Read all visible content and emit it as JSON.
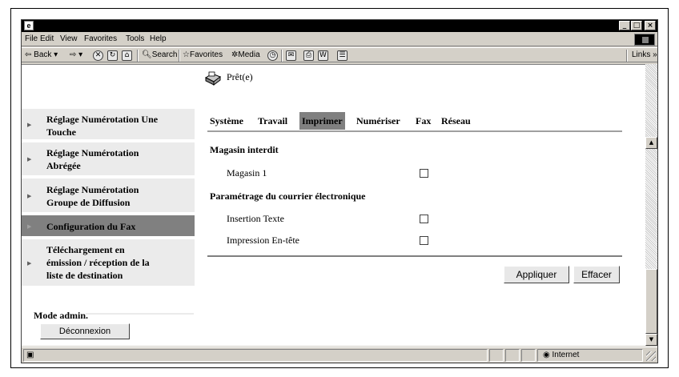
{
  "window": {
    "title_icon": "ie-page-icon",
    "controls": {
      "minimize": "_",
      "maximize": "□",
      "close": "×"
    }
  },
  "menu": {
    "items": [
      "File",
      "Edit",
      "View",
      "Favorites",
      "Tools",
      "Help"
    ]
  },
  "toolbar": {
    "back": "Back",
    "search": "Search",
    "favorites": "Favorites",
    "media": "Media",
    "links": "Links »"
  },
  "status": {
    "text": "Prêt(e)"
  },
  "sidebar": {
    "items": [
      {
        "label_lines": [
          "Réglage Numérotation Une",
          "Touche"
        ],
        "active": false
      },
      {
        "label_lines": [
          "Réglage Numérotation",
          "Abrégée"
        ],
        "active": false
      },
      {
        "label_lines": [
          "Réglage Numérotation",
          "Groupe de Diffusion"
        ],
        "active": false
      },
      {
        "label_lines": [
          "Configuration du Fax"
        ],
        "active": true
      },
      {
        "label_lines": [
          "Téléchargement en",
          "émission / réception de la",
          "liste de destination"
        ],
        "active": false
      }
    ],
    "admin_label": "Mode admin.",
    "logout_label": "Déconnexion"
  },
  "tabs": [
    {
      "label": "Système",
      "active": false
    },
    {
      "label": "Travail",
      "active": false
    },
    {
      "label": "Imprimer",
      "active": true
    },
    {
      "label": "Numériser",
      "active": false
    },
    {
      "label": "Fax",
      "active": false
    },
    {
      "label": "Réseau",
      "active": false
    }
  ],
  "form": {
    "section1": "Magasin interdit",
    "tray1_label": "Magasin 1",
    "tray1_checked": false,
    "section2": "Paramétrage du courrier électronique",
    "insert_text_label": "Insertion Texte",
    "insert_text_checked": false,
    "header_print_label": "Impression En-tête",
    "header_print_checked": false
  },
  "actions": {
    "apply": "Appliquer",
    "clear": "Effacer"
  },
  "statusbar": {
    "zone": "Internet"
  }
}
